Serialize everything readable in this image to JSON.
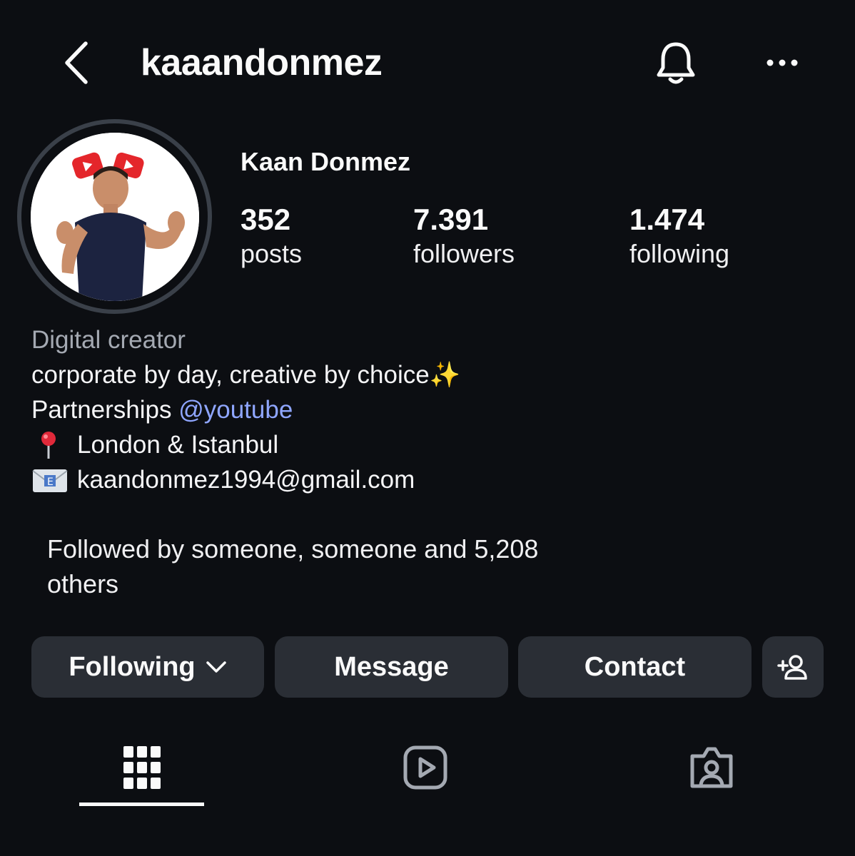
{
  "header": {
    "username": "kaaandonmez",
    "back_icon": "chevron-left-icon",
    "notify_icon": "bell-icon",
    "more_icon": "more-horizontal-icon"
  },
  "profile": {
    "display_name": "Kaan Donmez",
    "avatar": "profile-photo"
  },
  "stats": [
    {
      "value": "352",
      "label": "posts"
    },
    {
      "value": "7.391",
      "label": "followers"
    },
    {
      "value": "1.474",
      "label": "following"
    }
  ],
  "bio": {
    "category": "Digital creator",
    "line1": "corporate by day, creative by choice✨",
    "partnerships_prefix": "Partnerships ",
    "partnerships_link": "@youtube",
    "location": "London & Istanbul",
    "email": "kaandonmez1994@gmail.com"
  },
  "followed_by": {
    "line1": "Followed by someone, someone and 5,208",
    "line2": "others"
  },
  "actions": {
    "following_label": "Following",
    "message_label": "Message",
    "contact_label": "Contact",
    "add_user_icon": "add-person-icon"
  },
  "tabs": [
    {
      "name": "grid",
      "icon": "grid-icon",
      "selected": true
    },
    {
      "name": "reels",
      "icon": "reels-icon",
      "selected": false
    },
    {
      "name": "tagged",
      "icon": "tagged-person-icon",
      "selected": false
    }
  ],
  "colors": {
    "background": "#0c0e12",
    "button_bg": "#2a2e35",
    "link": "#8fa6ff",
    "category": "#a4a9b2"
  }
}
